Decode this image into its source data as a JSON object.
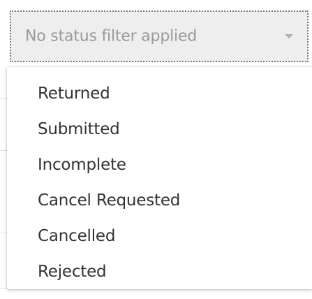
{
  "status_filter": {
    "value": "No status filter applied",
    "caret_icon": "caret-down-icon",
    "options": [
      {
        "label": "Returned"
      },
      {
        "label": "Submitted"
      },
      {
        "label": "Incomplete"
      },
      {
        "label": "Cancel Requested"
      },
      {
        "label": "Cancelled"
      },
      {
        "label": "Rejected"
      }
    ]
  },
  "colors": {
    "select_background": "#eeeeee",
    "select_text": "#9a9a9a",
    "menu_text": "#333333",
    "focus_outline": "#7a7a7a"
  }
}
